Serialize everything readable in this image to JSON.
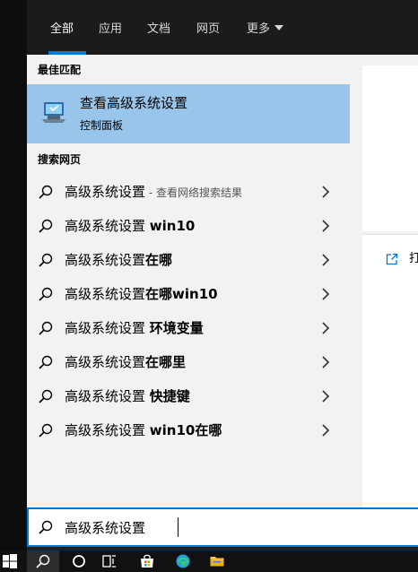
{
  "tabs": [
    {
      "label": "全部",
      "active": true
    },
    {
      "label": "应用",
      "active": false
    },
    {
      "label": "文档",
      "active": false
    },
    {
      "label": "网页",
      "active": false
    },
    {
      "label": "更多",
      "active": false
    }
  ],
  "best_match": {
    "heading": "最佳匹配",
    "title": "查看高级系统设置",
    "subtitle": "控制面板",
    "icon": "computer-settings-icon"
  },
  "web_search": {
    "heading": "搜索网页",
    "items": [
      {
        "prefix": "高级系统设置",
        "bold": "",
        "hint": " - 查看网络搜索结果"
      },
      {
        "prefix": "高级系统设置 ",
        "bold": "win10",
        "hint": ""
      },
      {
        "prefix": "高级系统设置",
        "bold": "在哪",
        "hint": ""
      },
      {
        "prefix": "高级系统设置",
        "bold": "在哪win10",
        "hint": ""
      },
      {
        "prefix": "高级系统设置 ",
        "bold": "环境变量",
        "hint": ""
      },
      {
        "prefix": "高级系统设置",
        "bold": "在哪里",
        "hint": ""
      },
      {
        "prefix": "高级系统设置 ",
        "bold": "快捷键",
        "hint": ""
      },
      {
        "prefix": "高级系统设置 ",
        "bold": "win10在哪",
        "hint": ""
      }
    ]
  },
  "preview": {
    "open_label": "打"
  },
  "search": {
    "value": "高级系统设置",
    "icon": "search-icon"
  },
  "taskbar": {
    "items": [
      "start-icon",
      "search-icon",
      "cortana-icon",
      "task-view-icon",
      "store-icon",
      "edge-icon",
      "file-explorer-icon"
    ]
  },
  "colors": {
    "accent": "#0078d7",
    "selection": "#99c5ea",
    "panel": "#f2f2f2",
    "header": "#1b1b1b"
  }
}
